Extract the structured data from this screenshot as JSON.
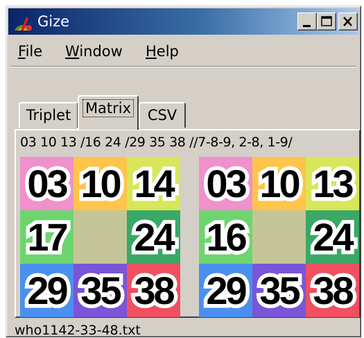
{
  "window": {
    "title": "Gize",
    "controls": [
      "minimize",
      "maximize",
      "close"
    ]
  },
  "menu": [
    {
      "label": "File",
      "mnemonic": "F"
    },
    {
      "label": "Window",
      "mnemonic": "W"
    },
    {
      "label": "Help",
      "mnemonic": "H"
    }
  ],
  "tabs": [
    {
      "label": "Triplet",
      "active": false
    },
    {
      "label": "Matrix",
      "active": true
    },
    {
      "label": "CSV",
      "active": false
    }
  ],
  "matrix": {
    "sequence": "03 10 13 /16 24 /29 35 38 //7-8-9, 2-8, 1-9/",
    "left": {
      "cells": [
        {
          "value": "03",
          "color": "#f090cc"
        },
        {
          "value": "10",
          "color": "#ffc44a"
        },
        {
          "value": "14",
          "color": "#d8e65a"
        },
        {
          "value": "17",
          "color": "#6ed56e"
        },
        {
          "value": "",
          "color": "#c4c597"
        },
        {
          "value": "24",
          "color": "#3aa866"
        },
        {
          "value": "29",
          "color": "#4a90f0"
        },
        {
          "value": "35",
          "color": "#7a55d8"
        },
        {
          "value": "38",
          "color": "#f05060"
        }
      ]
    },
    "right": {
      "cells": [
        {
          "value": "03",
          "color": "#f090cc"
        },
        {
          "value": "10",
          "color": "#ffc44a"
        },
        {
          "value": "13",
          "color": "#d8e65a"
        },
        {
          "value": "16",
          "color": "#6ed56e"
        },
        {
          "value": "",
          "color": "#c4c597"
        },
        {
          "value": "24",
          "color": "#3aa866"
        },
        {
          "value": "29",
          "color": "#4a90f0"
        },
        {
          "value": "35",
          "color": "#7a55d8"
        },
        {
          "value": "38",
          "color": "#f05060"
        }
      ]
    }
  },
  "status": {
    "filename": "who1142-33-48.txt"
  }
}
